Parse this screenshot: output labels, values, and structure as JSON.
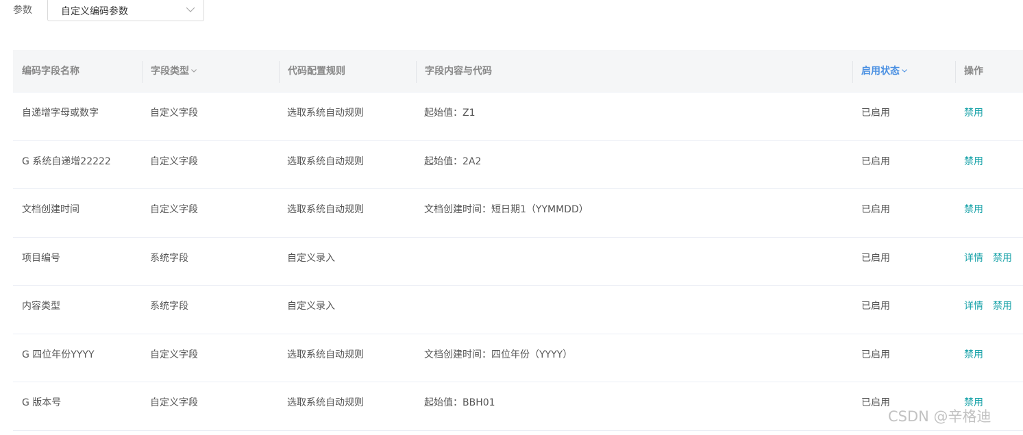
{
  "filter": {
    "label": "参数",
    "selected": "自定义编码参数",
    "arrow_icon": "chevron-down-icon"
  },
  "table": {
    "headers": [
      {
        "label": "编码字段名称",
        "sortable": false,
        "active": false
      },
      {
        "label": "字段类型",
        "sortable": true,
        "active": false
      },
      {
        "label": "代码配置规则",
        "sortable": false,
        "active": false
      },
      {
        "label": "字段内容与代码",
        "sortable": false,
        "active": false
      },
      {
        "label": "启用状态",
        "sortable": true,
        "active": true
      },
      {
        "label": "操作",
        "sortable": false,
        "active": false
      }
    ],
    "rows": [
      {
        "name": "自递增字母或数字",
        "type": "自定义字段",
        "rule": "选取系统自动规则",
        "content": "起始值：Z1",
        "status": "已启用",
        "detail": "",
        "disable": "禁用"
      },
      {
        "name": "G 系统自递增22222",
        "type": "自定义字段",
        "rule": "选取系统自动规则",
        "content": "起始值：2A2",
        "status": "已启用",
        "detail": "",
        "disable": "禁用"
      },
      {
        "name": "文档创建时间",
        "type": "自定义字段",
        "rule": "选取系统自动规则",
        "content": "文档创建时间：短日期1（YYMMDD）",
        "status": "已启用",
        "detail": "",
        "disable": "禁用"
      },
      {
        "name": "项目编号",
        "type": "系统字段",
        "rule": "自定义录入",
        "content": "",
        "status": "已启用",
        "detail": "详情",
        "disable": "禁用"
      },
      {
        "name": "内容类型",
        "type": "系统字段",
        "rule": "自定义录入",
        "content": "",
        "status": "已启用",
        "detail": "详情",
        "disable": "禁用"
      },
      {
        "name": "G 四位年份YYYY",
        "type": "自定义字段",
        "rule": "选取系统自动规则",
        "content": "文档创建时间：四位年份（YYYY）",
        "status": "已启用",
        "detail": "",
        "disable": "禁用"
      },
      {
        "name": "G 版本号",
        "type": "自定义字段",
        "rule": "选取系统自动规则",
        "content": "起始值：BBH01",
        "status": "已启用",
        "detail": "",
        "disable": "禁用"
      }
    ]
  },
  "watermark": "CSDN @辛格迪",
  "colors": {
    "link": "#17a2a8",
    "active_header": "#4a90e2",
    "header_bg": "#f5f6f7"
  }
}
